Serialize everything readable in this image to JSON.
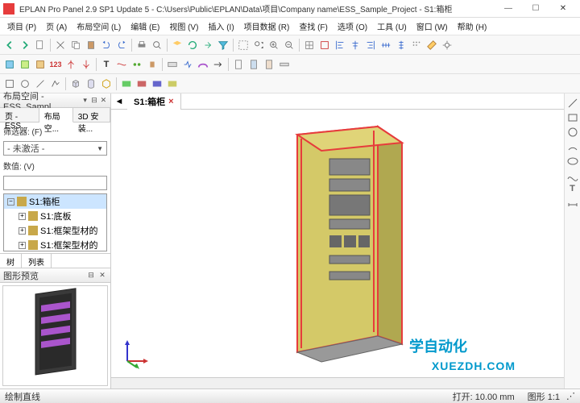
{
  "title": "EPLAN Pro Panel 2.9 SP1 Update 5 - C:\\Users\\Public\\EPLAN\\Data\\项目\\Company name\\ESS_Sample_Project - S1:箱柜",
  "menu": [
    "项目 (P)",
    "页 (A)",
    "布局空间 (L)",
    "编辑 (E)",
    "视图 (V)",
    "插入 (I)",
    "项目数据 (R)",
    "查找 (F)",
    "选项 (O)",
    "工具 (U)",
    "窗口 (W)",
    "帮助 (H)"
  ],
  "sidebar": {
    "panel_title": "布局空间 - ESS_Sampl...",
    "tabs": [
      "页 - ESS...",
      "布局空...",
      "3D 安装..."
    ],
    "active_tab": 1,
    "filter_label": "筛选器: (F)",
    "filter_value": "- 未激活 -",
    "value_label": "数值: (V)",
    "tree": [
      {
        "label": "S1:箱柜",
        "indent": 0,
        "exp": "-",
        "sel": true
      },
      {
        "label": "S1:底板",
        "indent": 1,
        "exp": "+"
      },
      {
        "label": "S1:框架型材的",
        "indent": 1,
        "exp": "+"
      },
      {
        "label": "S1:框架型材的",
        "indent": 1,
        "exp": "+"
      }
    ],
    "bottom_tabs": [
      "树",
      "列表"
    ],
    "active_btab": 0,
    "preview_title": "图形预览"
  },
  "canvas_tab": "S1:箱柜",
  "watermark_cn": "学自动化",
  "watermark": "XUEZDH.COM",
  "status": {
    "left": "绘制直线",
    "open": "打开: 10.00 mm",
    "scale": "图形 1:1"
  }
}
